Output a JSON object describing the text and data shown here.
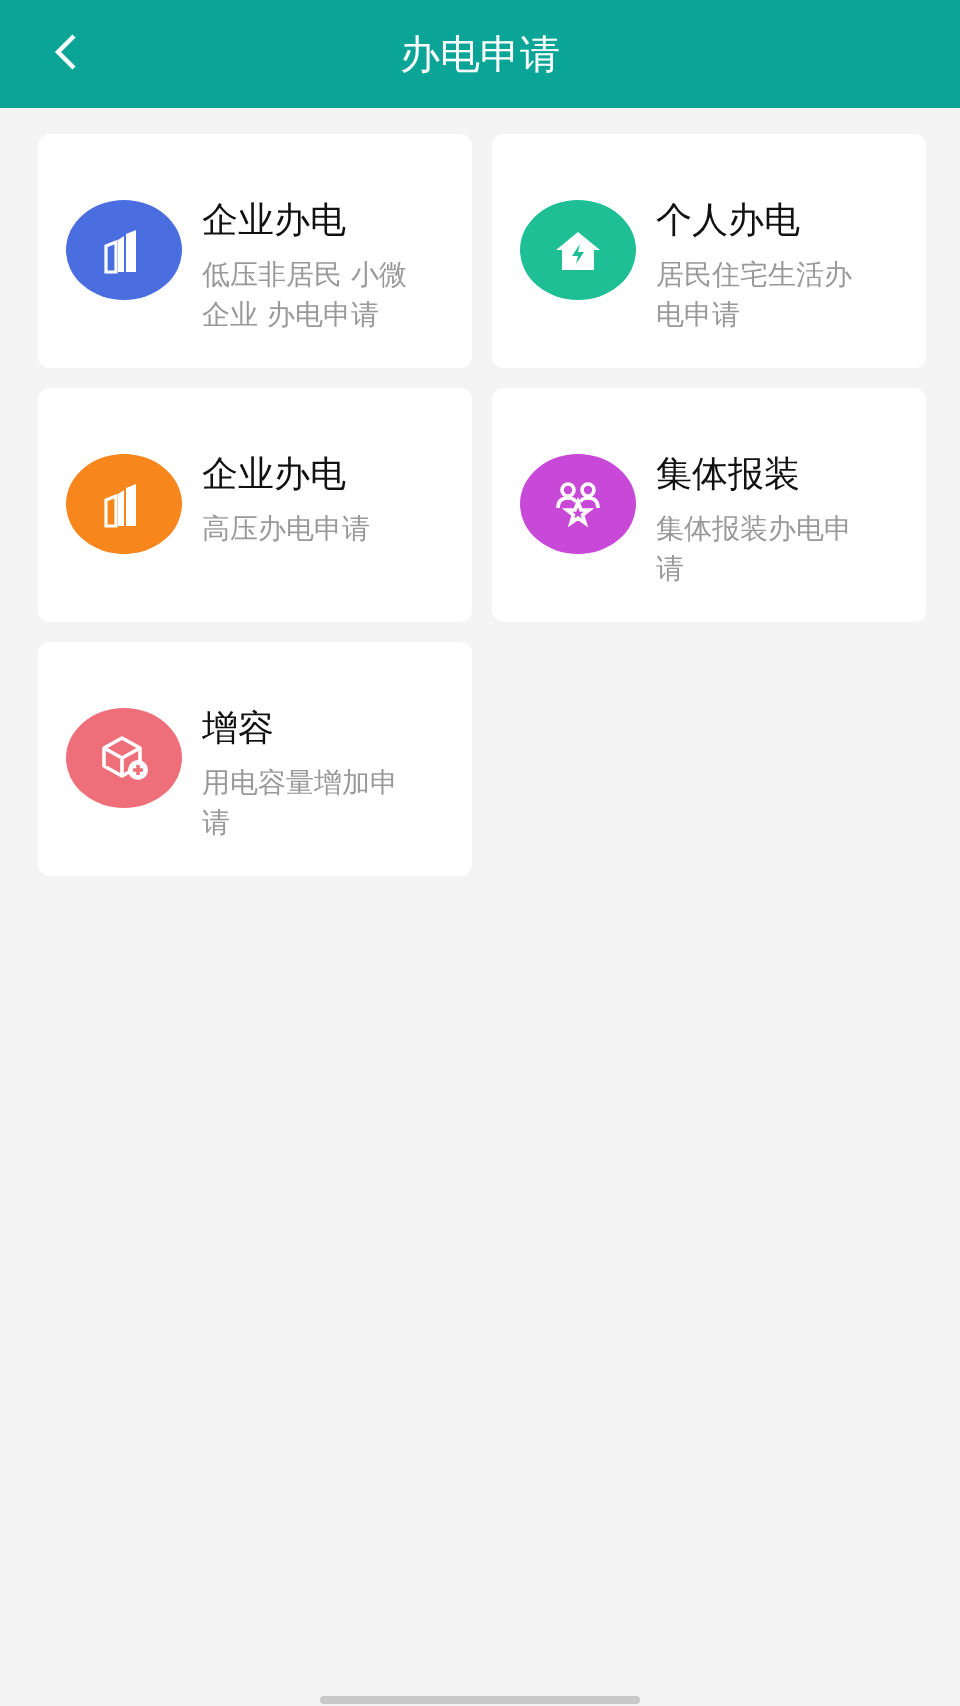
{
  "header": {
    "title": "办电申请"
  },
  "cards": [
    {
      "title": "企业办电",
      "description": "低压非居民 小微企业 办电申请",
      "kind": "building",
      "color": "#4a6ee0"
    },
    {
      "title": "个人办电",
      "description": "居民住宅生活办电申请",
      "kind": "house",
      "color": "#1fbf96"
    },
    {
      "title": "企业办电",
      "description": "高压办电申请",
      "kind": "building",
      "color": "#f7861c"
    },
    {
      "title": "集体报装",
      "description": "集体报装办电申请",
      "kind": "group",
      "color": "#c848d8"
    },
    {
      "title": "增容",
      "description": "用电容量增加申请",
      "kind": "box",
      "color": "#ee6f7a"
    }
  ]
}
